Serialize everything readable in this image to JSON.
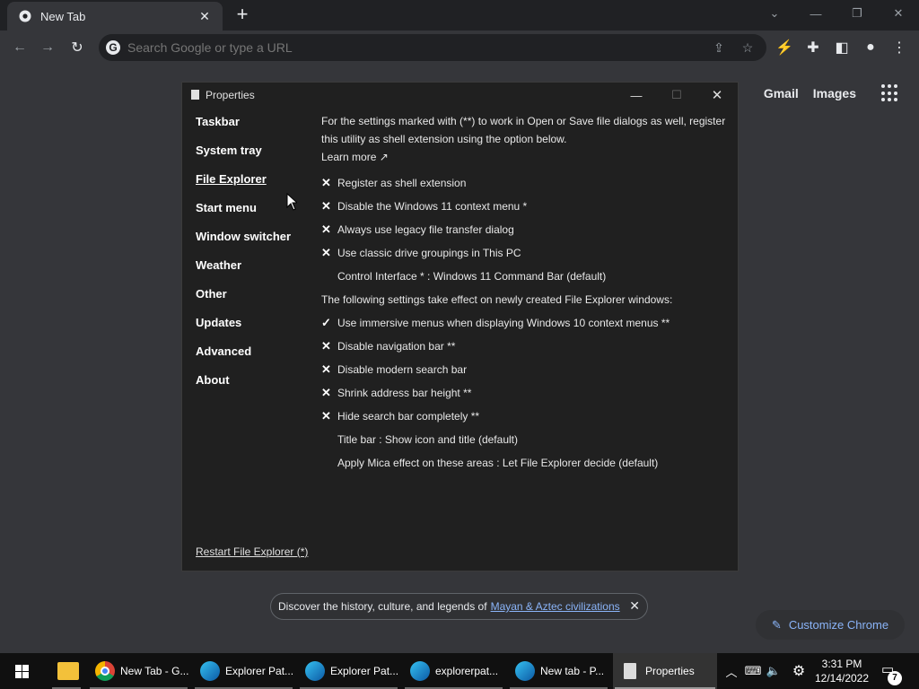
{
  "browser": {
    "tab_title": "New Tab",
    "newtab_symbol": "+",
    "omnibox_placeholder": "Search Google or type a URL",
    "google_links": [
      "Gmail",
      "Images"
    ]
  },
  "dialog": {
    "title": "Properties",
    "nav": [
      {
        "label": "Taskbar",
        "active": false
      },
      {
        "label": "System tray",
        "active": false
      },
      {
        "label": "File Explorer",
        "active": true
      },
      {
        "label": "Start menu",
        "active": false
      },
      {
        "label": "Window switcher",
        "active": false
      },
      {
        "label": "Weather",
        "active": false
      },
      {
        "label": "Other",
        "active": false
      },
      {
        "label": "Updates",
        "active": false
      },
      {
        "label": "Advanced",
        "active": false
      },
      {
        "label": "About",
        "active": false
      }
    ],
    "restart_link": "Restart File Explorer (*)",
    "info_text": "For the settings marked with (**) to work in Open or Save file dialogs as well, register this utility as shell extension using the option below.",
    "learn_more": "Learn more ↗",
    "options": [
      {
        "mark": "✕",
        "label": "Register as shell extension"
      },
      {
        "mark": "✕",
        "label": "Disable the Windows 11 context menu *"
      },
      {
        "mark": "✕",
        "label": "Always use legacy file transfer dialog"
      },
      {
        "mark": "✕",
        "label": "Use classic drive groupings in This PC"
      },
      {
        "mark": "",
        "label": "Control Interface * : Windows 11 Command Bar (default)"
      }
    ],
    "section_header": "The following settings take effect on newly created File Explorer windows:",
    "options2": [
      {
        "mark": "✓",
        "label": "Use immersive menus when displaying Windows 10 context menus **"
      },
      {
        "mark": "✕",
        "label": "Disable navigation bar **"
      },
      {
        "mark": "✕",
        "label": "Disable modern search bar"
      },
      {
        "mark": "✕",
        "label": "Shrink address bar height **"
      },
      {
        "mark": "✕",
        "label": "Hide search bar completely **"
      },
      {
        "mark": "",
        "label": "Title bar : Show icon and title (default)"
      },
      {
        "mark": "",
        "label": "Apply Mica effect on these areas : Let File Explorer decide (default)"
      }
    ]
  },
  "promo": {
    "text": "Discover the history, culture, and legends of",
    "link": "Mayan & Aztec civilizations"
  },
  "customize_label": "Customize Chrome",
  "taskbar": {
    "items": [
      {
        "label": "New Tab - G...",
        "icon": "chrome-icon"
      },
      {
        "label": "Explorer Pat...",
        "icon": "edge-icon"
      },
      {
        "label": "Explorer Pat...",
        "icon": "edge-icon"
      },
      {
        "label": "explorerpat...",
        "icon": "edge-icon"
      },
      {
        "label": "New tab - P...",
        "icon": "edge-icon"
      },
      {
        "label": "Properties",
        "icon": "document-icon"
      }
    ],
    "time": "3:31 PM",
    "date": "12/14/2022",
    "notification_count": "7"
  }
}
